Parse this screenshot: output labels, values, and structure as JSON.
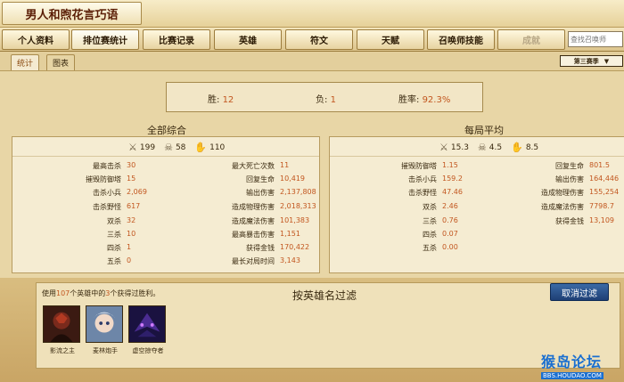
{
  "window": {
    "title": "男人和煦花言巧语"
  },
  "nav": {
    "items": [
      {
        "label": "个人资料"
      },
      {
        "label": "排位赛统计"
      },
      {
        "label": "比赛记录"
      },
      {
        "label": "英雄"
      },
      {
        "label": "符文"
      },
      {
        "label": "天赋"
      },
      {
        "label": "召唤师技能"
      },
      {
        "label": "成就"
      }
    ],
    "search_placeholder": "查找召唤师"
  },
  "subtabs": [
    {
      "label": "统计"
    },
    {
      "label": "图表"
    }
  ],
  "season": {
    "label": "第三赛季"
  },
  "summary": {
    "wins_label": "胜:",
    "wins": "12",
    "losses_label": "负:",
    "losses": "1",
    "rate_label": "胜率:",
    "rate": "92.3%"
  },
  "overall": {
    "title": "全部综合",
    "kills": "199",
    "deaths": "58",
    "assists": "110",
    "left": [
      {
        "label": "最高击杀",
        "value": "30"
      },
      {
        "label": "摧毁防御塔",
        "value": "15"
      },
      {
        "label": "击杀小兵",
        "value": "2,069"
      },
      {
        "label": "击杀野怪",
        "value": "617"
      },
      {
        "label": "双杀",
        "value": "32"
      },
      {
        "label": "三杀",
        "value": "10"
      },
      {
        "label": "四杀",
        "value": "1"
      },
      {
        "label": "五杀",
        "value": "0"
      }
    ],
    "right": [
      {
        "label": "最大死亡次数",
        "value": "11"
      },
      {
        "label": "回复生命",
        "value": "10,419"
      },
      {
        "label": "输出伤害",
        "value": "2,137,808"
      },
      {
        "label": "造成物理伤害",
        "value": "2,018,313"
      },
      {
        "label": "造成魔法伤害",
        "value": "101,383"
      },
      {
        "label": "最高暴击伤害",
        "value": "1,151"
      },
      {
        "label": "获得金钱",
        "value": "170,422"
      },
      {
        "label": "最长对局时间",
        "value": "3,143"
      }
    ]
  },
  "average": {
    "title": "每局平均",
    "kills": "15.3",
    "deaths": "4.5",
    "assists": "8.5",
    "left": [
      {
        "label": "摧毁防御塔",
        "value": "1.15"
      },
      {
        "label": "击杀小兵",
        "value": "159.2"
      },
      {
        "label": "击杀野怪",
        "value": "47.46"
      },
      {
        "label": "双杀",
        "value": "2.46"
      },
      {
        "label": "三杀",
        "value": "0.76"
      },
      {
        "label": "四杀",
        "value": "0.07"
      },
      {
        "label": "五杀",
        "value": "0.00"
      }
    ],
    "right": [
      {
        "label": "回复生命",
        "value": "801.5"
      },
      {
        "label": "输出伤害",
        "value": "164,446"
      },
      {
        "label": "造成物理伤害",
        "value": "155,254"
      },
      {
        "label": "造成魔法伤害",
        "value": "7798.7"
      },
      {
        "label": "获得金钱",
        "value": "13,109"
      }
    ]
  },
  "filter": {
    "usage_pre": "使用",
    "usage_total": "107",
    "usage_mid": "个英雄中的",
    "usage_won": "3",
    "usage_post": "个获得过胜利。",
    "title": "按英雄名过滤",
    "cancel_label": "取消过滤",
    "champions": [
      {
        "name": "影流之主"
      },
      {
        "name": "麦林炮手"
      },
      {
        "name": "虚空掠夺者"
      }
    ]
  },
  "watermark": {
    "text": "猴岛论坛",
    "url": "BBS.HOUDAO.COM"
  }
}
